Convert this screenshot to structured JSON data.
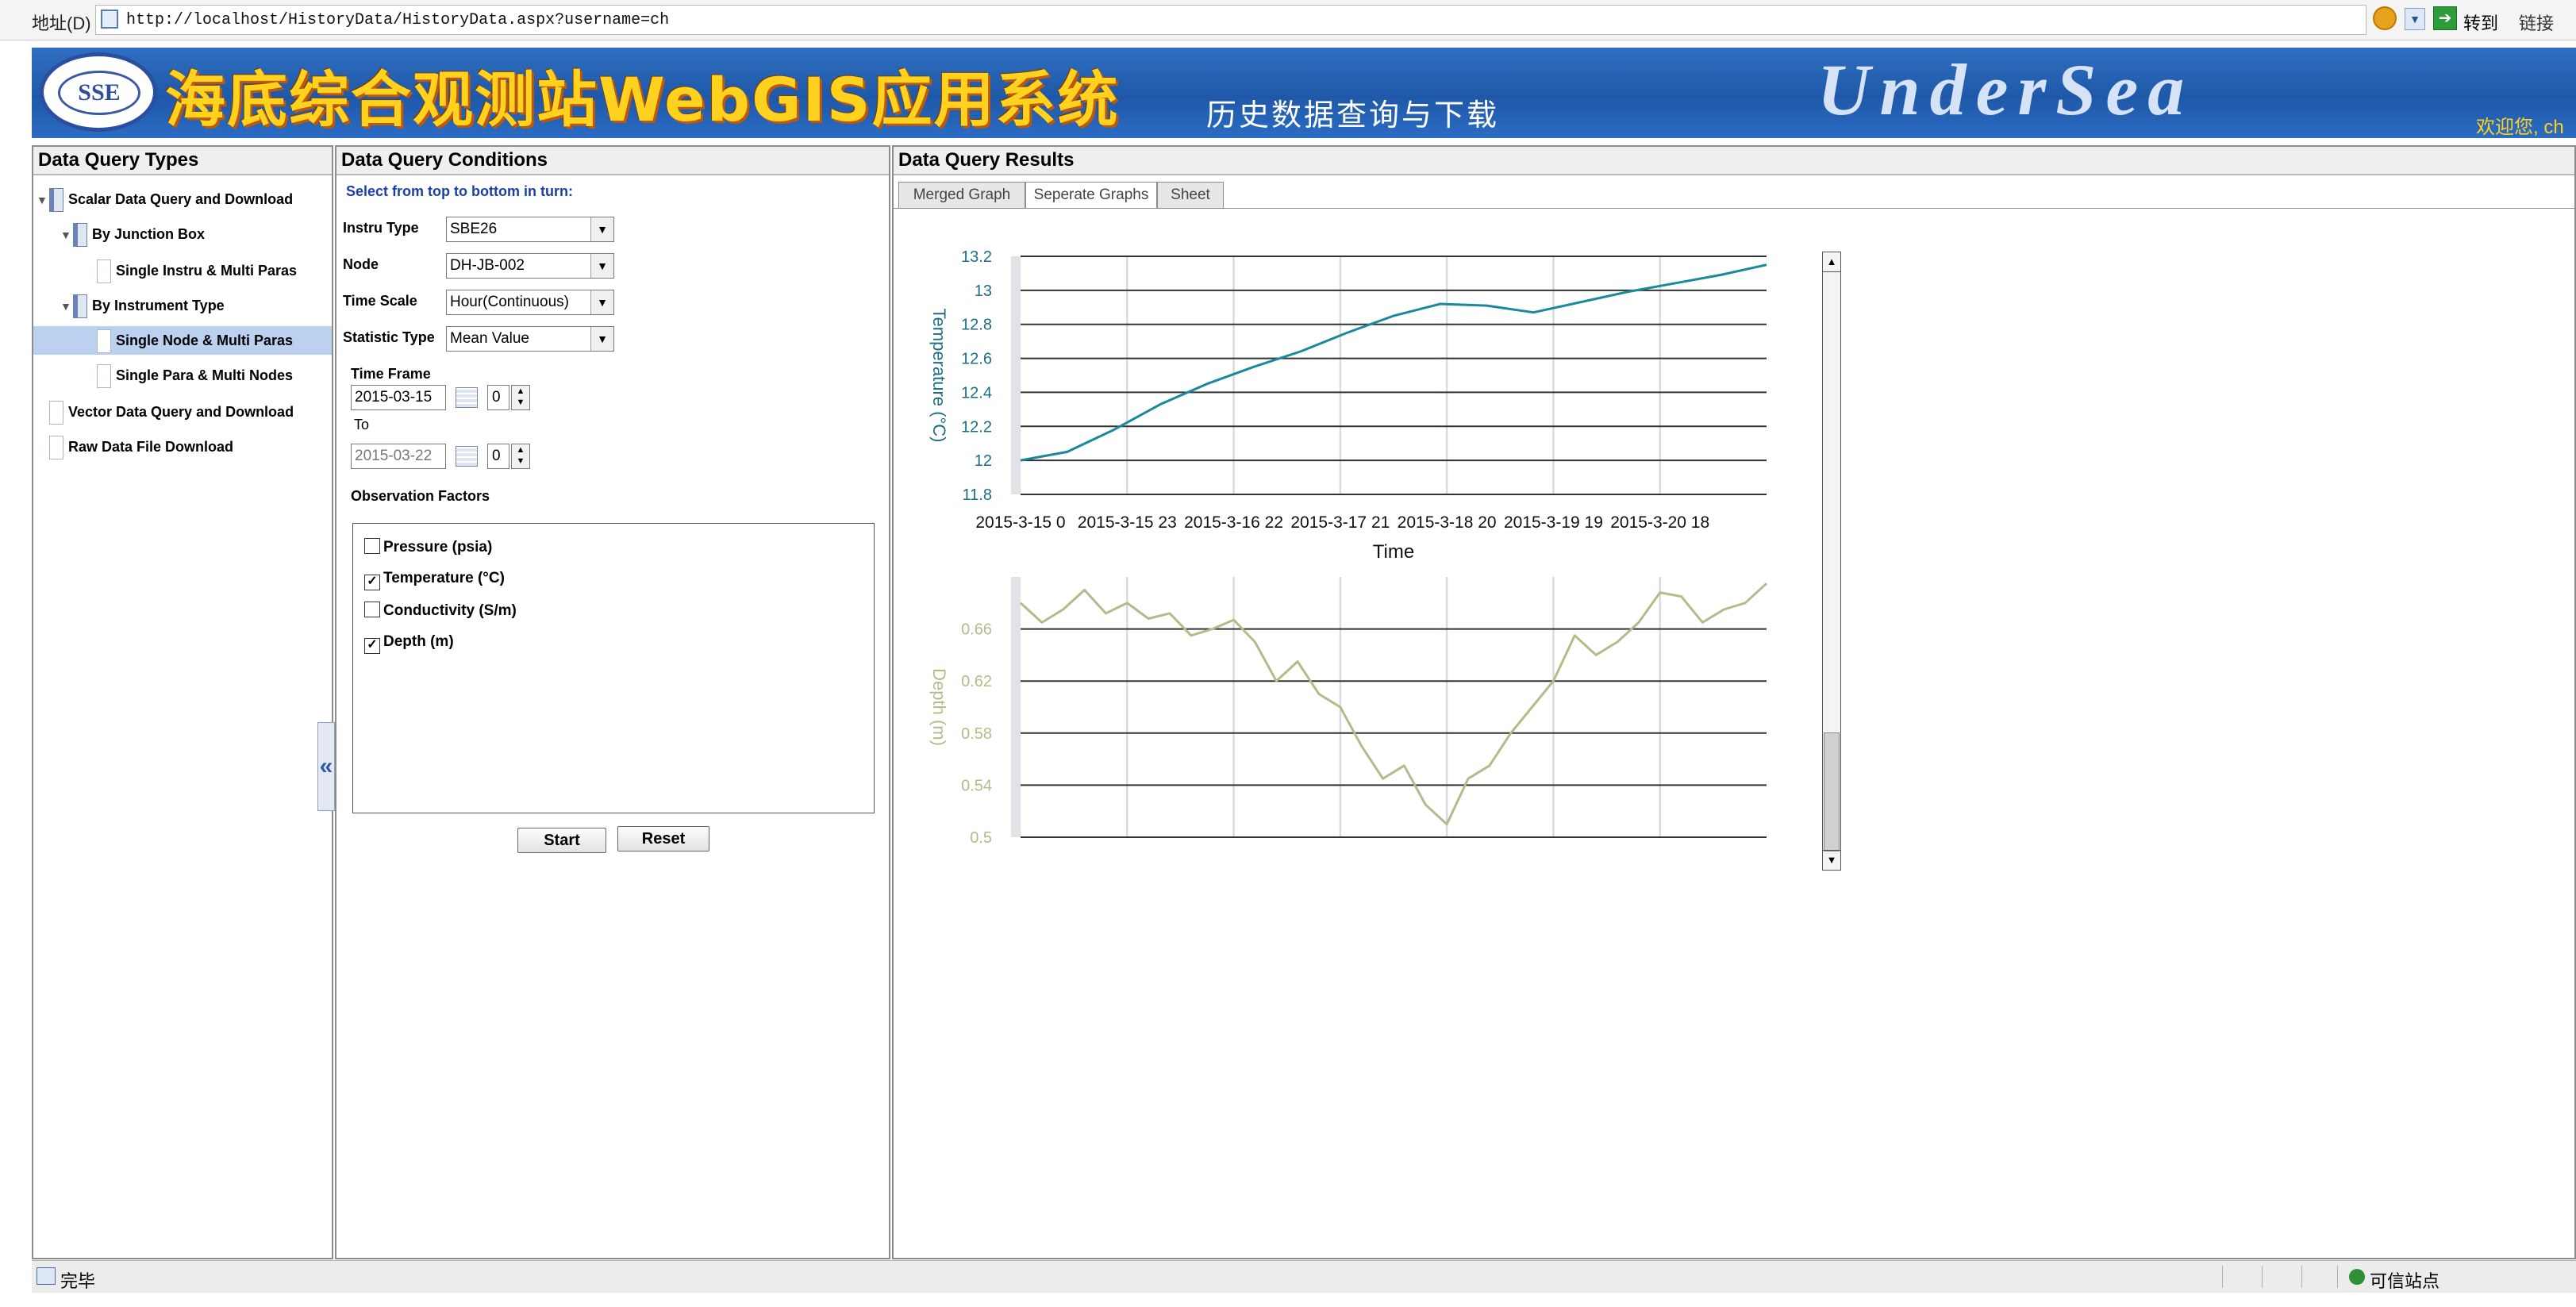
{
  "browser": {
    "address_label": "地址(D)",
    "url": "http://localhost/HistoryData/HistoryData.aspx?username=ch",
    "go_label": "转到",
    "links_label": "链接"
  },
  "banner": {
    "logo_text": "SSE",
    "title": "海底综合观测站WebGIS应用系统",
    "subtitle": "历史数据查询与下载",
    "brand": "UnderSea",
    "welcome": "欢迎您, ch"
  },
  "left_panel": {
    "header": "Data Query Types",
    "tree": [
      {
        "label": "Scalar Data Query and Download",
        "expanded": true,
        "icon": "folder-icon"
      },
      {
        "label": "By Junction Box",
        "expanded": true,
        "icon": "folder-icon"
      },
      {
        "label": "Single Instru & Multi Paras",
        "icon": "document-icon"
      },
      {
        "label": "By Instrument Type",
        "expanded": true,
        "icon": "folder-icon"
      },
      {
        "label": "Single Node & Multi Paras",
        "icon": "document-icon",
        "selected": true
      },
      {
        "label": "Single Para & Multi Nodes",
        "icon": "document-icon"
      },
      {
        "label": "Vector Data Query and Download",
        "icon": "document-icon"
      },
      {
        "label": "Raw Data File Download",
        "icon": "document-icon"
      }
    ],
    "collapse_glyph": "«"
  },
  "mid_panel": {
    "header": "Data Query Conditions",
    "instruction": "Select from top to bottom in turn:",
    "instru_type": {
      "label": "Instru Type",
      "value": "SBE26"
    },
    "node": {
      "label": "Node",
      "value": "DH-JB-002"
    },
    "time_scale": {
      "label": "Time Scale",
      "value": "Hour(Continuous)"
    },
    "statistic_type": {
      "label": "Statistic Type",
      "value": "Mean Value"
    },
    "time_frame": {
      "label": "Time Frame",
      "start_date": "2015-03-15",
      "start_hour": "0",
      "to_label": "To",
      "end_date": "2015-03-22",
      "end_hour": "0"
    },
    "factors_label": "Observation Factors",
    "factors": [
      {
        "label": "Pressure (psia)",
        "checked": false,
        "mark": ""
      },
      {
        "label": "Temperature (°C)",
        "checked": true,
        "mark": "✓"
      },
      {
        "label": "Conductivity (S/m)",
        "checked": false,
        "mark": ""
      },
      {
        "label": "Depth (m)",
        "checked": true,
        "mark": "✓"
      }
    ],
    "start_button": "Start",
    "reset_button": "Reset"
  },
  "right_panel": {
    "header": "Data Query Results",
    "tabs": [
      {
        "label": "Merged Graph",
        "active": false
      },
      {
        "label": "Seperate Graphs",
        "active": true
      },
      {
        "label": "Sheet",
        "active": false
      }
    ]
  },
  "chart_data": [
    {
      "type": "line",
      "series": [
        {
          "color": "#1a8a9a",
          "x": [
            "2015-3-15 0",
            "2015-3-15 12",
            "2015-3-15 23",
            "2015-3-16 10",
            "2015-3-16 22",
            "2015-3-17 9",
            "2015-3-17 21",
            "2015-3-18 8",
            "2015-3-18 20",
            "2015-3-18 23",
            "2015-3-19 4",
            "2015-3-19 8",
            "2015-3-19 19",
            "2015-3-20 6",
            "2015-3-20 18",
            "2015-3-21 5",
            "2015-3-21 17"
          ],
          "values": [
            12.0,
            12.05,
            12.18,
            12.33,
            12.45,
            12.55,
            12.64,
            12.75,
            12.85,
            12.92,
            12.91,
            12.87,
            12.93,
            12.99,
            13.04,
            13.09,
            13.15
          ]
        }
      ],
      "xlabel": "Time",
      "ylabel": "Temperature (°C)",
      "xticks": [
        "2015-3-15 0",
        "2015-3-15 23",
        "2015-3-16 22",
        "2015-3-17 21",
        "2015-3-18 20",
        "2015-3-19 19",
        "2015-3-20 18"
      ],
      "yticks": [
        "13.2",
        "13",
        "12.8",
        "12.6",
        "12.4",
        "12.2",
        "12",
        "11.8"
      ],
      "ylim": [
        11.8,
        13.2
      ],
      "grid": true
    },
    {
      "type": "line",
      "series": [
        {
          "color": "#b8b98a",
          "values": [
            0.68,
            0.665,
            0.675,
            0.69,
            0.672,
            0.68,
            0.668,
            0.672,
            0.655,
            0.66,
            0.667,
            0.65,
            0.62,
            0.635,
            0.61,
            0.6,
            0.57,
            0.545,
            0.555,
            0.525,
            0.51,
            0.545,
            0.555,
            0.58,
            0.6,
            0.62,
            0.655,
            0.64,
            0.65,
            0.665,
            0.688,
            0.685,
            0.665,
            0.675,
            0.68,
            0.695
          ]
        }
      ],
      "xlabel": "",
      "ylabel": "Depth (m)",
      "yticks": [
        "0.66",
        "0.62",
        "0.58",
        "0.54",
        "0.5"
      ],
      "ylim": [
        0.5,
        0.7
      ],
      "grid": true
    }
  ],
  "statusbar": {
    "text": "完毕",
    "zone": "可信站点"
  }
}
